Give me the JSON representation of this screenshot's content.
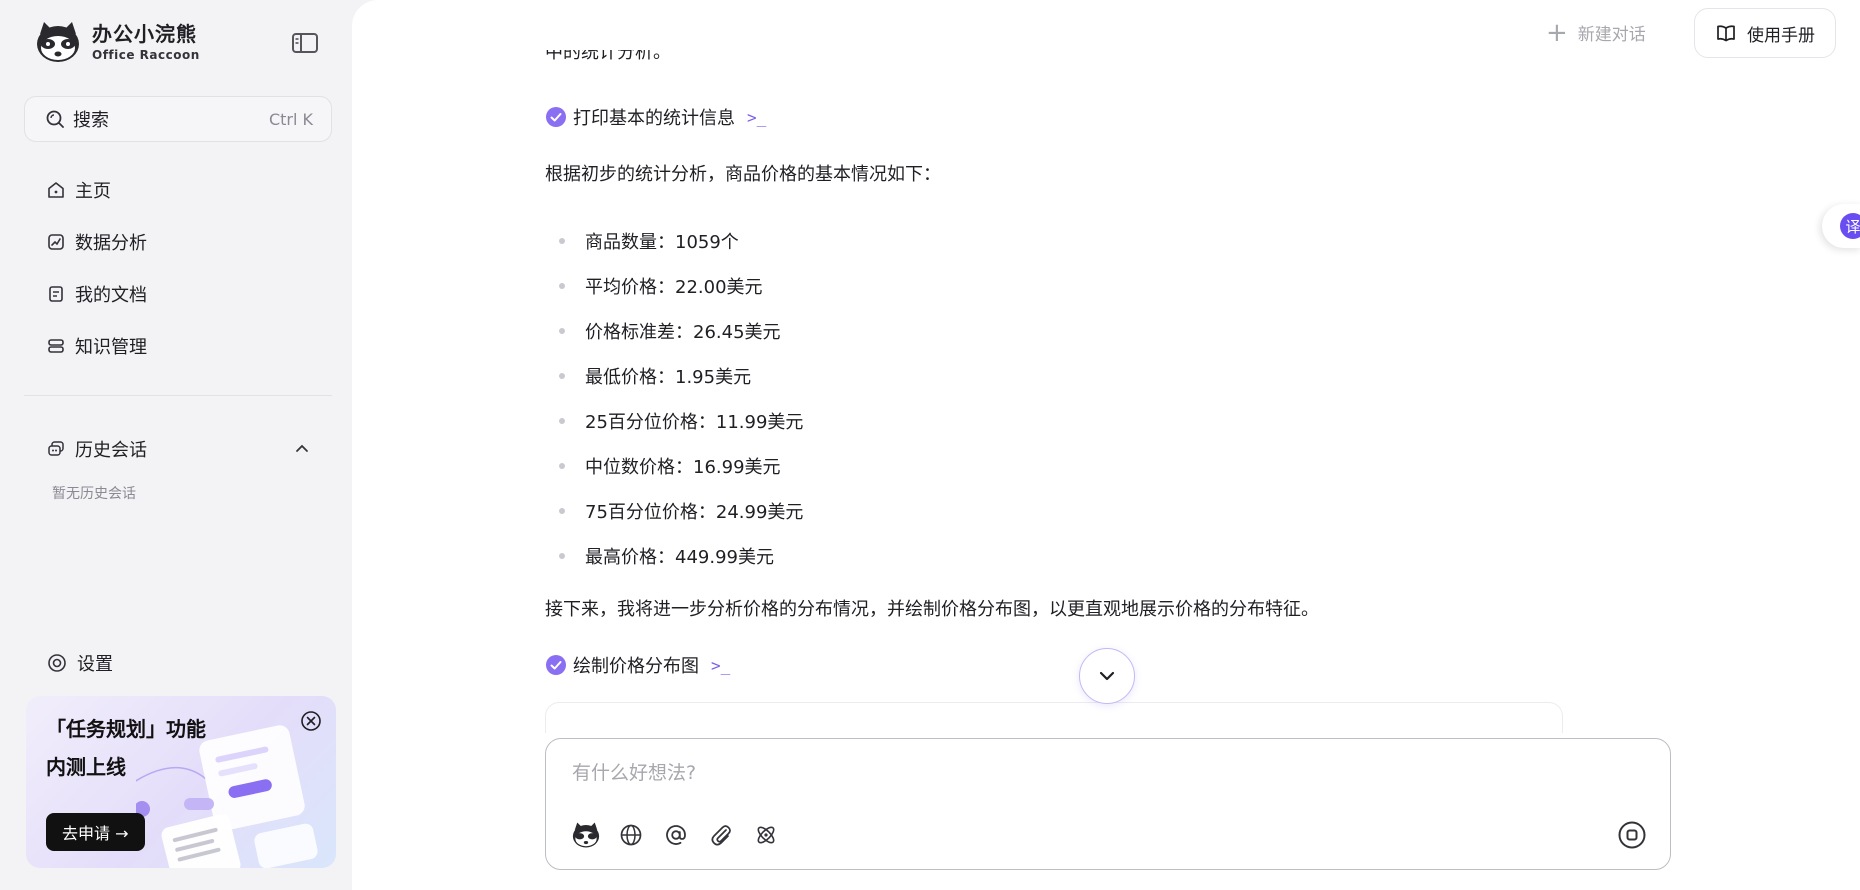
{
  "brand": {
    "name_cn": "办公小浣熊",
    "name_en": "Office Raccoon"
  },
  "sidebar": {
    "search": {
      "label": "搜索",
      "shortcut": "Ctrl K"
    },
    "nav": [
      {
        "label": "主页",
        "icon": "home-icon"
      },
      {
        "label": "数据分析",
        "icon": "chart-icon"
      },
      {
        "label": "我的文档",
        "icon": "document-icon"
      },
      {
        "label": "知识管理",
        "icon": "knowledge-icon"
      }
    ],
    "history": {
      "title": "历史会话",
      "empty": "暂无历史会话"
    },
    "settings": "设置",
    "promo": {
      "line1": "「任务规划」功能",
      "line2": "内测上线",
      "button": "去申请 →"
    }
  },
  "header": {
    "new_chat": "新建对话",
    "manual": "使用手册"
  },
  "chat": {
    "cut_text": "中的统计分析。",
    "step1": "打印基本的统计信息",
    "step_marker": ">_",
    "intro": "根据初步的统计分析，商品价格的基本情况如下：",
    "stats": [
      "商品数量：1059个",
      "平均价格：22.00美元",
      "价格标准差：26.45美元",
      "最低价格：1.95美元",
      "25百分位价格：11.99美元",
      "中位数价格：16.99美元",
      "75百分位价格：24.99美元",
      "最高价格：449.99美元"
    ],
    "next": "接下来，我将进一步分析价格的分布情况，并绘制价格分布图，以更直观地展示价格的分布特征。",
    "step2": "绘制价格分布图"
  },
  "composer": {
    "placeholder": "有什么好想法?"
  },
  "float_tab": {
    "label": "译"
  },
  "colors": {
    "accent": "#7c5cf0",
    "sidebar_bg": "#f3f3f5",
    "main_bg": "#ffffff"
  }
}
